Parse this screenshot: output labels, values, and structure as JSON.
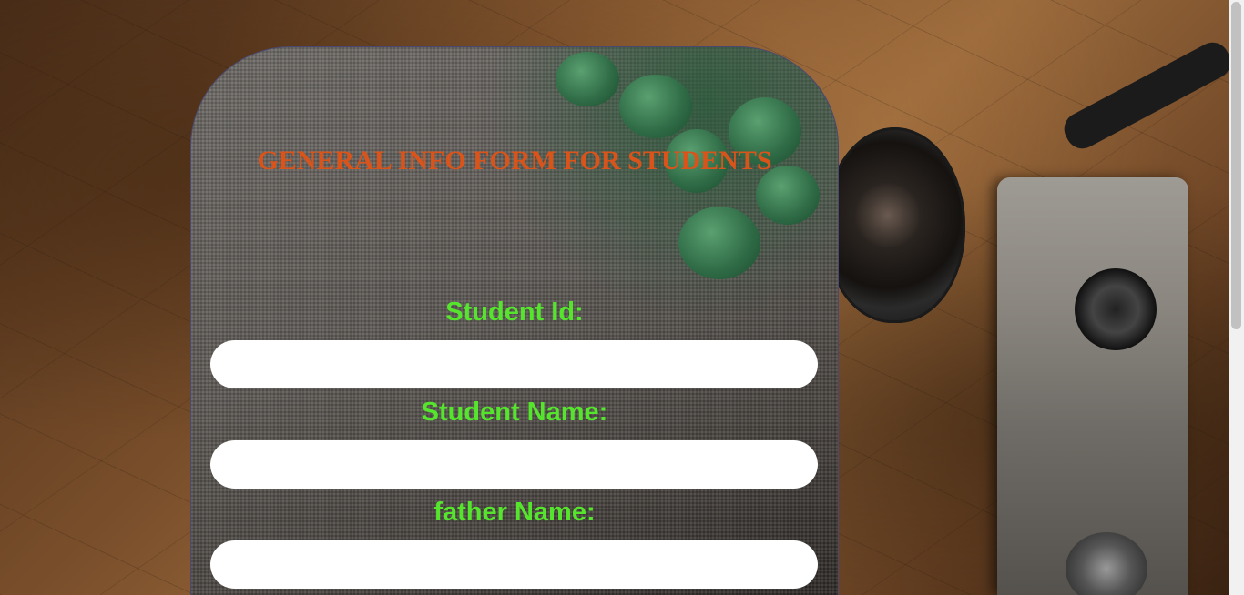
{
  "form": {
    "title": "GENERAL INFO FORM FOR STUDENTS",
    "fields": [
      {
        "label": "Student Id:",
        "value": "",
        "placeholder": ""
      },
      {
        "label": "Student Name:",
        "value": "",
        "placeholder": ""
      },
      {
        "label": "father Name:",
        "value": "",
        "placeholder": ""
      }
    ]
  },
  "colors": {
    "title": "#d9541b",
    "label": "#55e52c",
    "input_bg": "#ffffff",
    "card_border": "#4a4870"
  }
}
